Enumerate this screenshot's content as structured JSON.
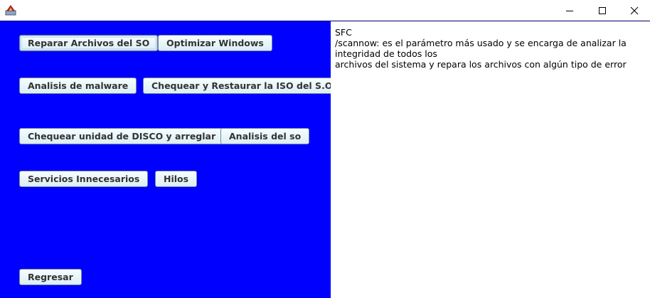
{
  "window": {
    "icon": "java-app-icon",
    "controls": [
      "minimize-icon",
      "maximize-icon",
      "close-icon"
    ]
  },
  "colors": {
    "panel_background": "#0000ff",
    "button_background": "#e3f4f8",
    "text_area_background": "#ffffff"
  },
  "buttons": {
    "repair": "Reparar Archivos del SO",
    "optimize": "Optimizar Windows",
    "malware": "Analisis de malware",
    "iso": "Chequear y Restaurar la ISO del S.O",
    "disk": "Chequear unidad de DISCO y arreglar",
    "os_analysis": "Analisis del so",
    "services": "Servicios Innecesarios",
    "threads": "Hilos",
    "back": "Regresar"
  },
  "output": {
    "lines": [
      "SFC",
      "/scannow: es el parámetro más usado y se encarga de analizar la",
      "integridad de todos los",
      "archivos del sistema y repara los archivos con algún tipo de error"
    ]
  }
}
